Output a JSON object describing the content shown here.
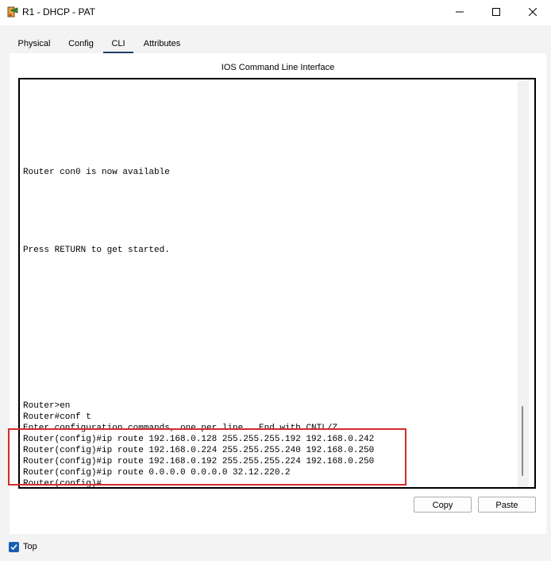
{
  "window": {
    "title": "R1 - DHCP - PAT",
    "controls": [
      "minimize",
      "maximize",
      "close"
    ]
  },
  "tabs": [
    {
      "label": "Physical",
      "active": false
    },
    {
      "label": "Config",
      "active": false
    },
    {
      "label": "CLI",
      "active": true
    },
    {
      "label": "Attributes",
      "active": false
    }
  ],
  "cli": {
    "panel_title": "IOS Command Line Interface",
    "lines": [
      "Router con0 is now available",
      "Press RETURN to get started.",
      "Router>en",
      "Router#conf t",
      "Enter configuration commands, one per line.  End with CNTL/Z.",
      "Router(config)#ip route 192.168.0.128 255.255.255.192 192.168.0.242",
      "Router(config)#ip route 192.168.0.224 255.255.255.240 192.168.0.250",
      "Router(config)#ip route 192.168.0.192 255.255.255.224 192.168.0.250",
      "Router(config)#ip route 0.0.0.0 0.0.0.0 32.12.220.2",
      "Router(config)#"
    ],
    "highlight_color": "#d42b2b"
  },
  "buttons": {
    "copy": "Copy",
    "paste": "Paste"
  },
  "footer": {
    "top_label": "Top",
    "top_checked": true
  },
  "colors": {
    "tab_underline": "#1f3f66",
    "checkbox": "#1a5fb4"
  }
}
